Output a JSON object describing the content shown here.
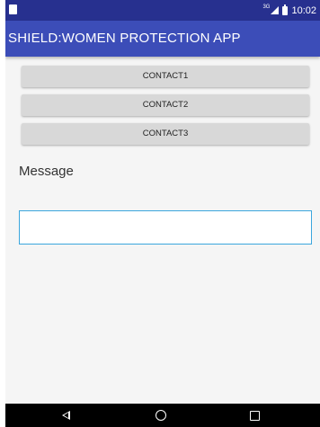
{
  "status_bar": {
    "network_label": "3G",
    "time": "10:02",
    "icons": [
      "app-notification-icon",
      "signal-icon",
      "battery-icon"
    ]
  },
  "toolbar": {
    "title": "SHIELD:WOMEN PROTECTION APP"
  },
  "buttons": [
    {
      "label": "CONTACT1"
    },
    {
      "label": "CONTACT2"
    },
    {
      "label": "CONTACT3"
    }
  ],
  "message": {
    "label": "Message",
    "value": ""
  },
  "nav_bar": {
    "icons": [
      "back-icon",
      "home-icon",
      "recents-icon"
    ]
  },
  "colors": {
    "status_bar": "#27308f",
    "toolbar": "#3c4db8",
    "button": "#d8d8d8",
    "input_border": "#3ba6dd",
    "nav_bar": "#000000"
  }
}
